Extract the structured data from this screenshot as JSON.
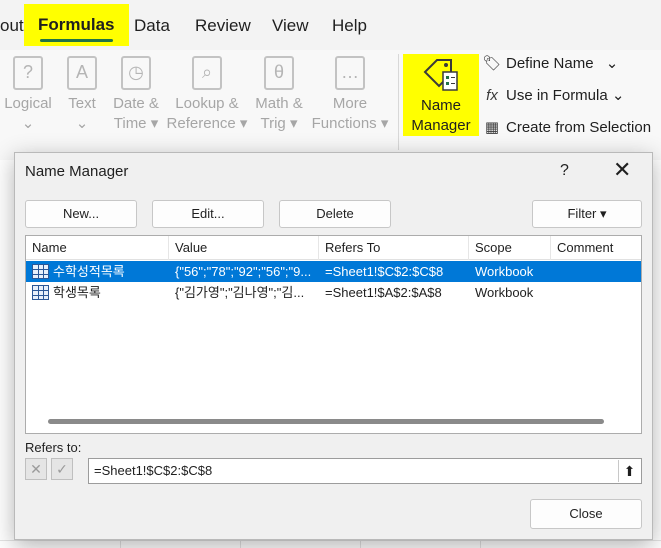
{
  "ribbon_tabs": [
    {
      "label": "out"
    },
    {
      "label": "Formulas"
    },
    {
      "label": "Data"
    },
    {
      "label": "Review"
    },
    {
      "label": "View"
    },
    {
      "label": "Help"
    }
  ],
  "function_library": {
    "items": [
      {
        "line1": "Logical",
        "line2": "",
        "icon": "?"
      },
      {
        "line1": "Text",
        "line2": "",
        "icon": "A"
      },
      {
        "line1": "Date &",
        "line2": "Time ▾",
        "icon": "◷"
      },
      {
        "line1": "Lookup &",
        "line2": "Reference ▾",
        "icon": "⌕"
      },
      {
        "line1": "Math &",
        "line2": "Trig ▾",
        "icon": "θ"
      },
      {
        "line1": "More",
        "line2": "Functions ▾",
        "icon": "…"
      }
    ]
  },
  "defined_names": {
    "name_manager_line1": "Name",
    "name_manager_line2": "Manager",
    "define_name": "Define Name",
    "use_in_formula": "Use in Formula",
    "create_from_selection": "Create from Selection"
  },
  "dialog": {
    "title": "Name Manager",
    "help": "?",
    "close": "✕",
    "buttons": {
      "new": "New...",
      "edit": "Edit...",
      "delete": "Delete",
      "filter": "Filter ▾",
      "close": "Close"
    },
    "columns": [
      "Name",
      "Value",
      "Refers To",
      "Scope",
      "Comment"
    ],
    "rows": [
      {
        "name": "수학성적목록",
        "value": "{\"56\";\"78\";\"92\";\"56\";\"9...",
        "refers_to": "=Sheet1!$C$2:$C$8",
        "scope": "Workbook",
        "comment": "",
        "selected": true
      },
      {
        "name": "학생목록",
        "value": "{\"김가영\";\"김나영\";\"김...",
        "refers_to": "=Sheet1!$A$2:$A$8",
        "scope": "Workbook",
        "comment": "",
        "selected": false
      }
    ],
    "refers_to_label": "Refers to:",
    "refers_to_value": "=Sheet1!$C$2:$C$8"
  },
  "colors": {
    "highlight": "#ffff00",
    "selection": "#0078d7",
    "accent": "#217346"
  }
}
